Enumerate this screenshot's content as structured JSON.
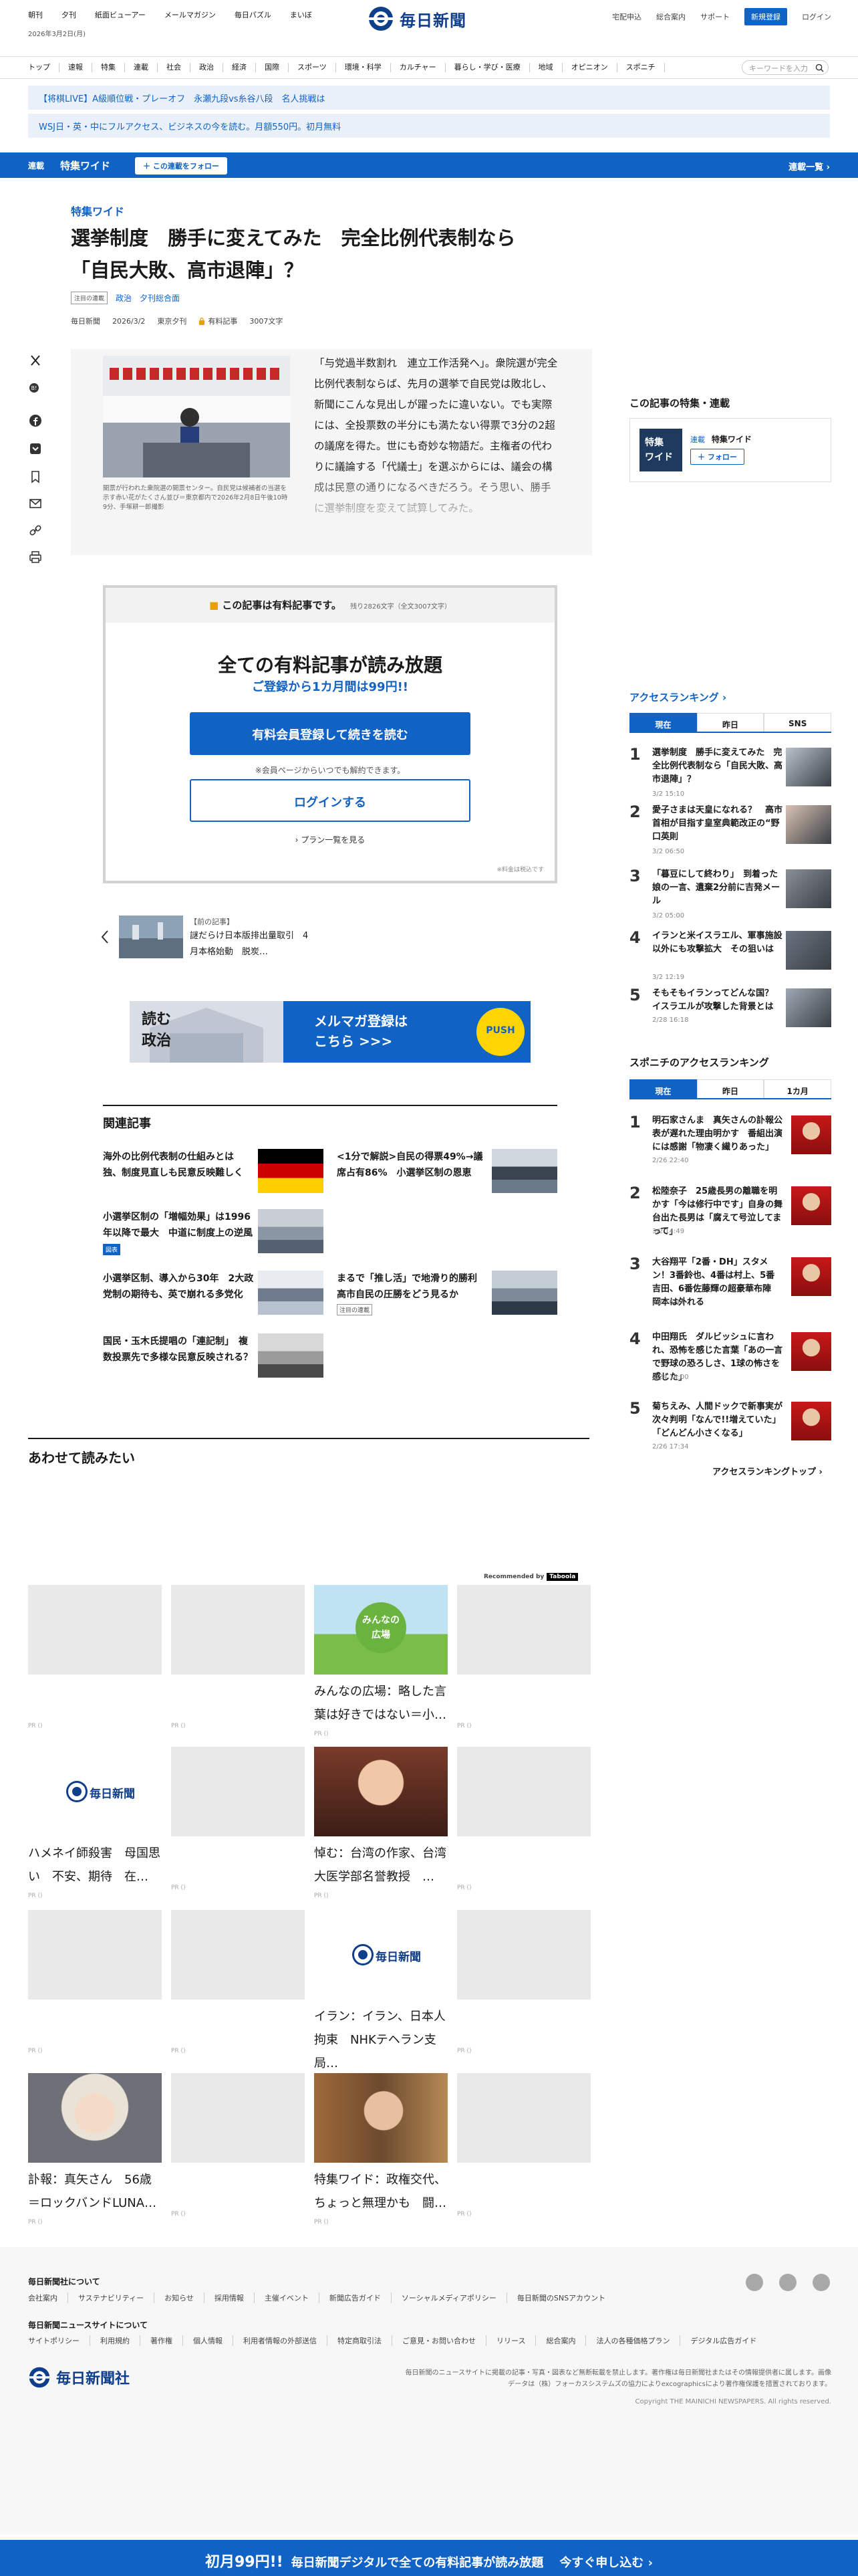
{
  "header": {
    "left_links": [
      "朝刊",
      "夕刊",
      "紙面ビューアー",
      "メールマガジン",
      "毎日パズル",
      "まいぼ"
    ],
    "date": "2026年3月2日(月)",
    "logo_text": "毎日新聞",
    "right_links": [
      "宅配申込",
      "総合案内",
      "サポート"
    ],
    "register": "新規登録",
    "login": "ログイン"
  },
  "nav": {
    "items": [
      "トップ",
      "速報",
      "特集",
      "連載",
      "社会",
      "政治",
      "経済",
      "国際",
      "スポーツ",
      "環境・科学",
      "カルチャー",
      "暮らし・学び・医療",
      "地域",
      "オピニオン",
      "スポニチ"
    ],
    "search_placeholder": "キーワードを入力"
  },
  "promos": [
    "【将棋LIVE】A級順位戦・プレーオフ　永瀬九段vs糸谷八段　名人挑戦は",
    "WSJ日・英・中にフルアクセス、ビジネスの今を読む。月額550円。初月無料"
  ],
  "series_bar": {
    "label": "連載",
    "title": "特集ワイド",
    "follow": "＋ この連載をフォロー",
    "list": "連載一覧 ›"
  },
  "article": {
    "series": "特集ワイド",
    "title_lines": [
      "選挙制度　勝手に変えてみた　完全比例代表制なら",
      "「自民大敗、高市退陣」？"
    ],
    "tag_box": "注目の連載",
    "tags": [
      "政治",
      "夕刊総合面"
    ],
    "meta": {
      "source": "毎日新聞",
      "date": "2026/3/2",
      "edition": "東京夕刊",
      "paid": "有料記事",
      "length": "3007文字"
    },
    "caption": "開票が行われた衆院選の開票センター。自民党は候補者の当選を示す赤い花がたくさん並び＝東京都内で2026年2月8日午後10時9分、手塚耕一郎撮影",
    "lead": "「与党過半数割れ　連立工作活発へ」。衆院選が完全比例代表制ならば、先月の選挙で自民党は敗北し、新聞にこんな見出しが躍ったに違いない。でも実際には、全投票数の半分にも満たない得票で3分の2超の議席を得た。世にも奇妙な物語だ。主権者の代わりに議論する「代議士」を選ぶからには、議会の構成は民意の通りになるべきだろう。そう思い、勝手に選挙制度を変えて試算してみた。"
  },
  "paywall": {
    "head": "この記事は有料記事です。",
    "remaining": "残り2826文字（全文3007文字）",
    "main": "全ての有料記事が読み放題",
    "sub": "ご登録から1カ月間は99円!!",
    "register_btn": "有料会員登録して続きを読む",
    "note": "※会員ページからいつでも解約できます。",
    "login_btn": "ログインする",
    "plans": "プラン一覧を見る",
    "tax": "※料金は税込です"
  },
  "prev_article": {
    "label": "【前の記事】",
    "title": "謎だらけ日本版排出量取引　4月本格始動　脱炭…"
  },
  "mail_banner": {
    "left": "読む\n政治",
    "main": "メルマガ登録は\nこちら >>>",
    "push": "PUSH"
  },
  "related": {
    "heading": "関連記事",
    "items": [
      {
        "title": "海外の比例代表制の仕組みとは　独、制度見直しも民意反映難しく",
        "badge": ""
      },
      {
        "title": "<1分で解説>自民の得票49%→議席占有86%　小選挙区制の恩恵",
        "badge": ""
      },
      {
        "title": "小選挙区制の「増幅効果」は1996年以降で最大　中道に制度上の逆風",
        "badge": "図表"
      },
      {
        "title": "小選挙区制、導入から30年　2大政党制の期待も、英で崩れる多党化",
        "badge": ""
      },
      {
        "title": "まるで「推し活」で地滑り的勝利　高市自民の圧勝をどう見るか",
        "badge": "注目の連載"
      },
      {
        "title": "国民・玉木氏提唱の「連記制」　複数投票先で多様な民意反映される？",
        "badge": ""
      }
    ]
  },
  "read_together": {
    "heading": "あわせて読みたい",
    "recommended": "Recommended by",
    "taboola": "Taboola",
    "pr": "PR ()",
    "cards": [
      {
        "title": "みんなの広場：略した言葉は好きではない＝小…",
        "img": "minna"
      },
      {
        "title": "ハメネイ師殺害　母国思い　不安、期待　在…",
        "img": "logo"
      },
      {
        "title": "悼む：台湾の作家、台湾大医学部名誉教授　…",
        "img": "portrait1"
      },
      {
        "title": "イラン：イラン、日本人拘束　NHKテヘラン支局…",
        "img": "logo"
      },
      {
        "title": "訃報：真矢さん　56歳＝ロックバンドLUNA…",
        "img": "portrait2"
      },
      {
        "title": "特集ワイド：政権交代、ちょっと無理かも　闘…",
        "img": "portrait3"
      }
    ],
    "minna_img_text": "みんなの\n広場"
  },
  "sidebar": {
    "special_head": "この記事の特集・連載",
    "special_label_small": "連載",
    "special_label": "特集ワイド",
    "special_follow": "＋ フォロー",
    "special_img_text": "特集\nワイド",
    "ranking_head": "アクセスランキング",
    "ranking_tabs": [
      "現在",
      "昨日",
      "SNS"
    ],
    "ranking": [
      {
        "num": "1",
        "title": "選挙制度　勝手に変えてみた　完全比例代表制なら「自民大敗、高市退陣」？",
        "date": "3/2 15:10",
        "paid": true
      },
      {
        "num": "2",
        "title": "愛子さまは天皇になれる？　高市首相が目指す皇室典範改正の“野口英則",
        "date": "3/2 06:50",
        "paid": true
      },
      {
        "num": "3",
        "title": "「暮豆にして終わり」　到着った娘の一言、遺棄2分前に吉発メール",
        "date": "3/2 05:00",
        "paid": true
      },
      {
        "num": "4",
        "title": "イランと米イスラエル、軍事施設以外にも攻撃拡大　その狙いは",
        "date": "3/2 12:19",
        "paid": true
      },
      {
        "num": "5",
        "title": "そもそもイランってどんな国？　イスラエルが攻撃した背景とは",
        "date": "2/28 16:18",
        "paid": false
      }
    ],
    "sponichi_head": "スポニチのアクセスランキング",
    "sponichi_tabs": [
      "現在",
      "昨日",
      "1カ月"
    ],
    "sponichi": [
      {
        "num": "1",
        "title": "明石家さんま　真矢さんの訃報公表が遅れた理由明かす　番組出演には感謝「物凄く繊りあった」",
        "date": "2/26 22:40"
      },
      {
        "num": "2",
        "title": "松陸奈子　25歳長男の離職を明かす「今は修行中です」自身の舞台出た長男は「腐えて号泣してまって」",
        "date": "3/2 14:49"
      },
      {
        "num": "3",
        "title": "大谷翔平「2番・DH」スタメン！3番鈴也、4番は村上、5番吉田、6番佐藤輝の超豪華布陣　岡本は外れる",
        "date": "3/2 16:44"
      },
      {
        "num": "4",
        "title": "中田翔氏　ダルビッシュに言われ、恐怖を感じた言葉「あの一言で野球の恐ろしさ、1球の怖さを感じた」",
        "date": "2/24 14:00"
      },
      {
        "num": "5",
        "title": "菊ちえみ、人間ドックで新事実が次々判明「なんで!!増えていた」「どんどん小さくなる」",
        "date": "2/26 17:34"
      }
    ],
    "ranking_top": "アクセスランキングトップ ›"
  },
  "footer": {
    "about_head": "毎日新聞社について",
    "about_links": [
      "会社案内",
      "サステナビリティー",
      "お知らせ",
      "採用情報",
      "主催イベント",
      "新聞広告ガイド",
      "ソーシャルメディアポリシー",
      "毎日新聞のSNSアカウント"
    ],
    "site_head": "毎日新聞ニュースサイトについて",
    "site_links": [
      "サイトポリシー",
      "利用規約",
      "著作権",
      "個人情報",
      "利用者情報の外部送信",
      "特定商取引法",
      "ご意見・お問い合わせ",
      "リリース",
      "総合案内",
      "法人の各種価格プラン",
      "デジタル広告ガイド"
    ],
    "logo": "毎日新聞社",
    "note": "毎日新聞のニュースサイトに掲載の記事・写真・図表など無断転載を禁止します。著作権は毎日新聞社またはその情報提供者に属します。画像データは（株）フォーカスシステムズの協力によりexcographicsにより著作権保護を措置されております。",
    "copyright": "Copyright THE MAINICHI NEWSPAPERS. All rights reserved."
  },
  "cta": {
    "price": "初月99円!!",
    "text": "毎日新聞デジタルで全ての有料記事が読み放題",
    "go": "今すぐ申し込む ›"
  },
  "colors": {
    "brand": "#1062c4",
    "logo": "#0f3e8a"
  }
}
